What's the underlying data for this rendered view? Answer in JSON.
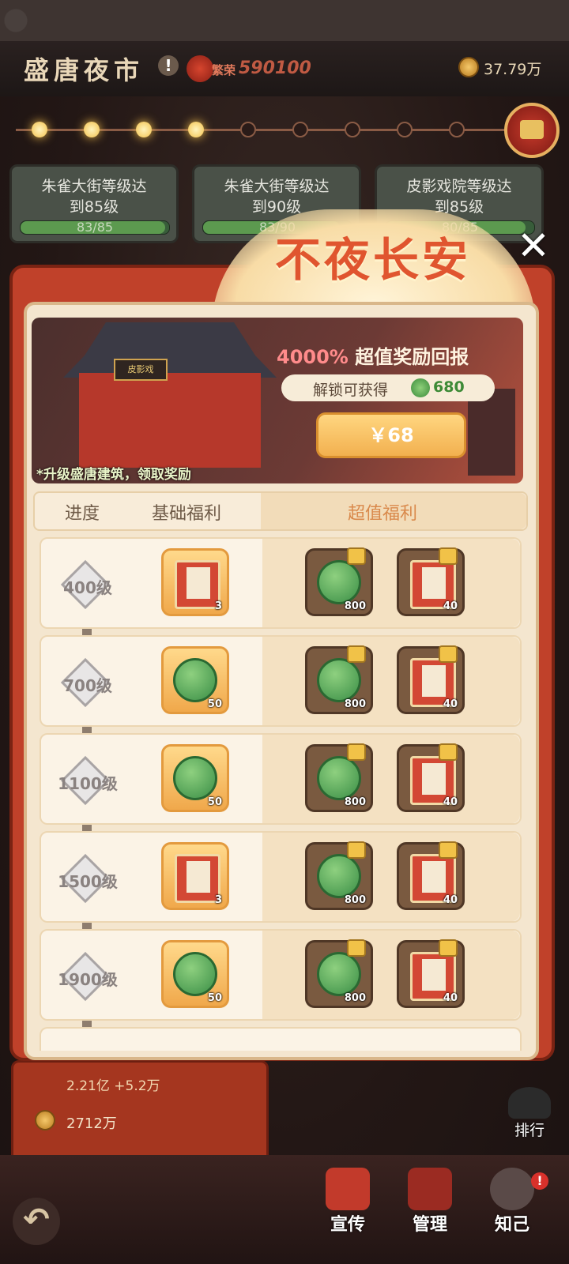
{
  "header": {
    "title": "盛唐夜市",
    "info_icon": "!",
    "prosperity_label": "繁荣",
    "prosperity_value": "590100",
    "coins": "37.79万"
  },
  "tasks": [
    {
      "line1": "朱雀大街等级达",
      "line2": "到85级",
      "progress": "83/85",
      "progress_value": 0.976
    },
    {
      "line1": "朱雀大街等级达",
      "line2": "到90级",
      "progress": "83/90",
      "progress_value": 0.92
    },
    {
      "line1": "皮影戏院等级达",
      "line2": "到85级",
      "progress": "80/85",
      "progress_value": 0.94
    }
  ],
  "progress_beads": {
    "lit": 4,
    "total": 9
  },
  "modal": {
    "title": "不夜长安",
    "close": "✕",
    "banner": {
      "sign": "皮影戏",
      "promo_percent": "4000%",
      "promo_text": "超值奖励回报",
      "unlock_label": "解锁可获得",
      "unlock_value": "680",
      "price": "￥68",
      "tip": "*升级盛唐建筑，领取奖励"
    },
    "columns": {
      "progress": "进度",
      "basic": "基础福利",
      "premium": "超值福利"
    },
    "rows": [
      {
        "level": "400级",
        "free": {
          "icon": "card-icon",
          "count": "3"
        },
        "premium": [
          {
            "icon": "jade-icon",
            "count": "800"
          },
          {
            "icon": "card-icon",
            "count": "40"
          }
        ]
      },
      {
        "level": "700级",
        "free": {
          "icon": "jade-icon",
          "count": "50"
        },
        "premium": [
          {
            "icon": "jade-icon",
            "count": "800"
          },
          {
            "icon": "card-icon",
            "count": "40"
          }
        ]
      },
      {
        "level": "1100级",
        "free": {
          "icon": "jade-icon",
          "count": "50"
        },
        "premium": [
          {
            "icon": "jade-icon",
            "count": "800"
          },
          {
            "icon": "card-icon",
            "count": "40"
          }
        ]
      },
      {
        "level": "1500级",
        "free": {
          "icon": "card-icon",
          "count": "3"
        },
        "premium": [
          {
            "icon": "jade-icon",
            "count": "800"
          },
          {
            "icon": "card-icon",
            "count": "40"
          }
        ]
      },
      {
        "level": "1900级",
        "free": {
          "icon": "jade-icon",
          "count": "50"
        },
        "premium": [
          {
            "icon": "jade-icon",
            "count": "800"
          },
          {
            "icon": "card-icon",
            "count": "40"
          }
        ]
      }
    ]
  },
  "stats": {
    "row1": "2.21亿 +5.2万",
    "row2": "2712万"
  },
  "nav": {
    "rank": "排行",
    "promote": "宣传",
    "manage": "管理",
    "friend": "知己",
    "alert": "!"
  },
  "colors": {
    "accent_red": "#c0412a",
    "gold": "#f2b04f",
    "jade": "#3a8e46"
  }
}
